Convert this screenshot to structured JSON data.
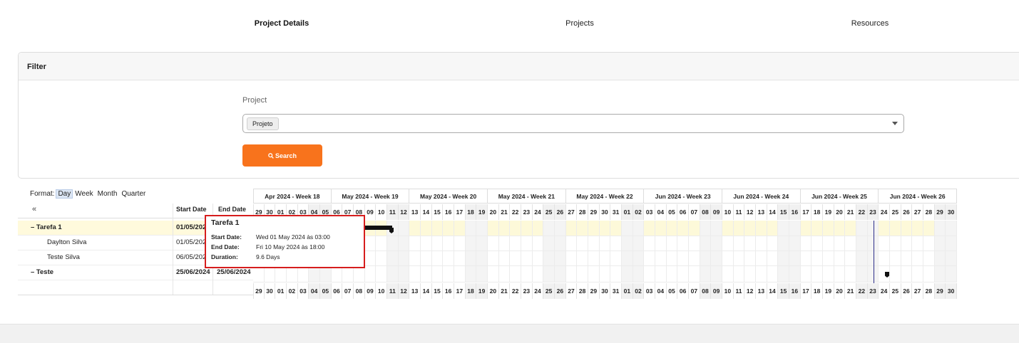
{
  "tabs": [
    {
      "label": "Project Details",
      "active": true
    },
    {
      "label": "Projects",
      "active": false
    },
    {
      "label": "Resources",
      "active": false
    }
  ],
  "filter": {
    "title": "Filter",
    "project_label": "Project",
    "project_value": "Projeto",
    "search_label": "Search"
  },
  "gantt": {
    "format_label": "Format:",
    "formats": [
      "Day",
      "Week",
      "Month",
      "Quarter"
    ],
    "selected_format": "Day",
    "collapse_symbol": "«",
    "col_start": "Start Date",
    "col_end": "End Date",
    "rows": [
      {
        "name": "– Tarefa 1",
        "start": "01/05/2024",
        "end": "",
        "bold": true,
        "indent": 0
      },
      {
        "name": "Daylton Silva",
        "start": "01/05/2024",
        "end": "",
        "bold": false,
        "indent": 1
      },
      {
        "name": "Teste Silva",
        "start": "06/05/2024",
        "end": "",
        "bold": false,
        "indent": 1
      },
      {
        "name": "– Teste",
        "start": "25/06/2024",
        "end": "25/06/2024",
        "bold": true,
        "indent": 0
      }
    ],
    "weeks": [
      "Apr 2024 - Week 18",
      "May 2024 - Week 19",
      "May 2024 - Week 20",
      "May 2024 - Week 21",
      "May 2024 - Week 22",
      "Jun 2024 - Week 23",
      "Jun 2024 - Week 24",
      "Jun 2024 - Week 25",
      "Jun 2024 - Week 26"
    ],
    "days": [
      "29",
      "30",
      "01",
      "02",
      "03",
      "04",
      "05",
      "06",
      "07",
      "08",
      "09",
      "10",
      "11",
      "12",
      "13",
      "14",
      "15",
      "16",
      "17",
      "18",
      "19",
      "20",
      "21",
      "22",
      "23",
      "24",
      "25",
      "26",
      "27",
      "28",
      "29",
      "30",
      "31",
      "01",
      "02",
      "03",
      "04",
      "05",
      "06",
      "07",
      "08",
      "09",
      "10",
      "11",
      "12",
      "13",
      "14",
      "15",
      "16",
      "17",
      "18",
      "19",
      "20",
      "21",
      "22",
      "23",
      "24",
      "25",
      "26",
      "27",
      "28",
      "29",
      "30"
    ],
    "weekend_indices": [
      5,
      6,
      12,
      13,
      19,
      20,
      26,
      27,
      33,
      34,
      40,
      41,
      47,
      48,
      54,
      55,
      61,
      62
    ],
    "today_index": 55
  },
  "tooltip": {
    "title": "Tarefa 1",
    "start_key": "Start Date:",
    "start_val": "Wed 01 May 2024 às 03:00",
    "end_key": "End Date:",
    "end_val": "Fri 10 May 2024 às 18:00",
    "dur_key": "Duration:",
    "dur_val": "9.6 Days"
  }
}
